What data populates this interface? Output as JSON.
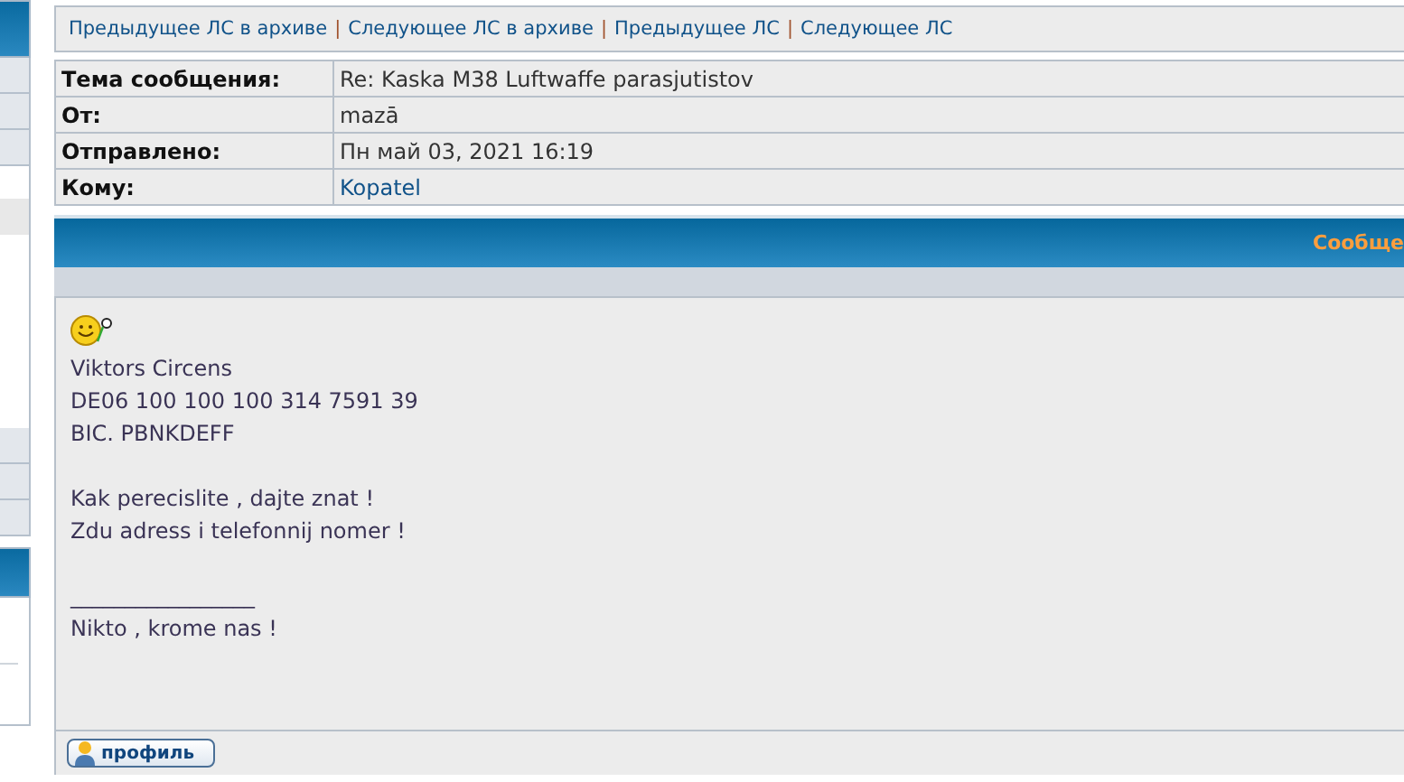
{
  "nav": {
    "links": [
      "Предыдущее ЛС в архиве",
      "Следующее ЛС в архиве",
      "Предыдущее ЛС",
      "Следующее ЛС"
    ],
    "separator": "|"
  },
  "header": [
    {
      "label": "Тема сообщения:",
      "value": "Re: Kaska M38 Luftwaffe parasjutistov",
      "link": false
    },
    {
      "label": "От:",
      "value": "mazā",
      "link": false
    },
    {
      "label": "Отправлено:",
      "value": "Пн май 03, 2021 16:19",
      "link": false
    },
    {
      "label": "Кому:",
      "value": "Kopatel",
      "link": true
    }
  ],
  "message": {
    "title": "Сообще",
    "paragraphs": [
      [
        "Viktors Circens",
        "DE06 100 100 100 314 7591 39",
        "BIC. PBNKDEFF"
      ],
      [
        "Kak perecislite , dajte znat !",
        "Zdu adress i telefonnij nomer !"
      ]
    ],
    "signature": {
      "rule": "_________________",
      "text": "Nikto , krome nas !"
    }
  },
  "buttons": [
    "профиль"
  ]
}
